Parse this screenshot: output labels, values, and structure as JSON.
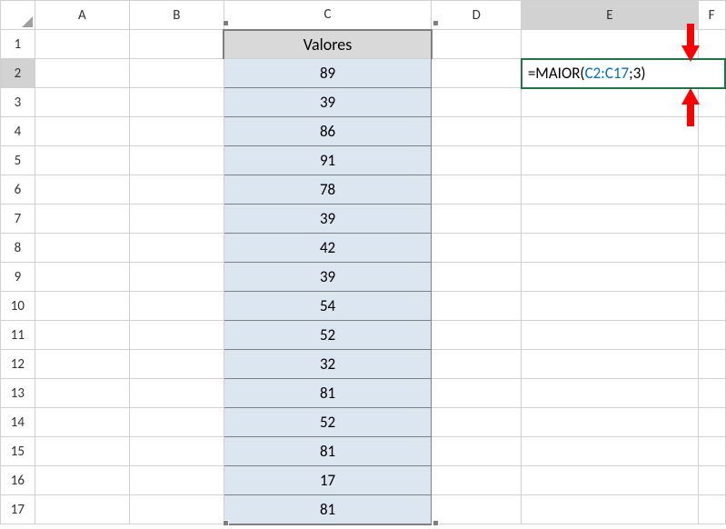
{
  "columns": [
    "A",
    "B",
    "C",
    "D",
    "E",
    "F"
  ],
  "rows": [
    "1",
    "2",
    "3",
    "4",
    "5",
    "6",
    "7",
    "8",
    "9",
    "10",
    "11",
    "12",
    "13",
    "14",
    "15",
    "16",
    "17"
  ],
  "headerCell": "Valores",
  "dataValues": [
    "89",
    "39",
    "86",
    "91",
    "78",
    "39",
    "42",
    "39",
    "54",
    "52",
    "32",
    "81",
    "52",
    "81",
    "17",
    "81"
  ],
  "formula": {
    "prefix": "=MAIOR(",
    "ref": "C2:C17",
    "sep": ";",
    "arg": "3",
    "suffix": ")"
  }
}
